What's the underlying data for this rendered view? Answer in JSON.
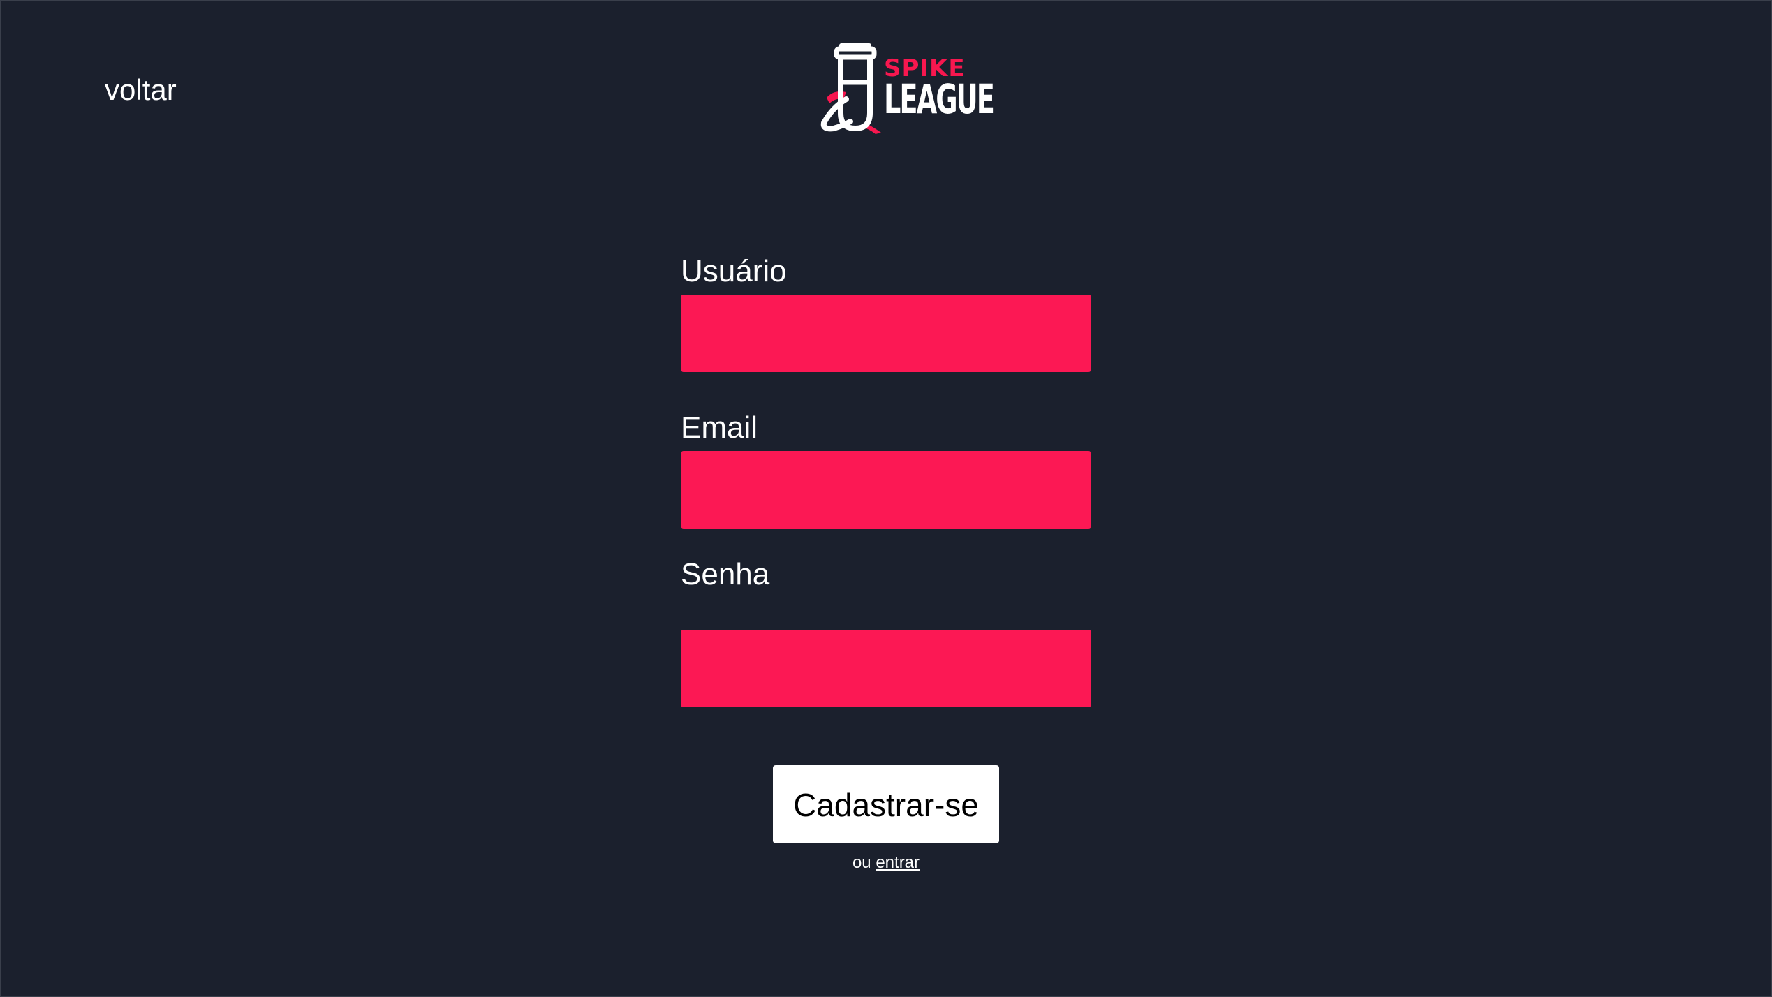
{
  "nav": {
    "back_label": "voltar"
  },
  "logo": {
    "line1": "SPIKE",
    "line2": "LEAGUE"
  },
  "form": {
    "username_label": "Usuário",
    "username_value": "",
    "email_label": "Email",
    "email_value": "",
    "password_label": "Senha",
    "password_value": "",
    "submit_label": "Cadastrar-se",
    "alt_prefix": "ou",
    "alt_link": "entrar"
  },
  "colors": {
    "background": "#1b202d",
    "accent": "#fc1854",
    "text": "#ffffff",
    "button_bg": "#ffffff",
    "button_text": "#000000"
  }
}
